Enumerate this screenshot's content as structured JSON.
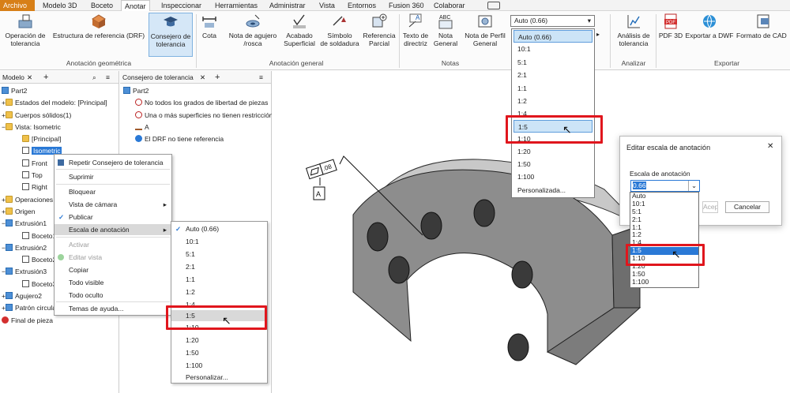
{
  "menu_tabs": [
    "Archivo",
    "Modelo 3D",
    "Boceto",
    "Anotar",
    "Inspeccionar",
    "Herramientas",
    "Administrar",
    "Vista",
    "Entornos",
    "Fusion 360",
    "Colaborar"
  ],
  "ribbon": {
    "buttons": [
      {
        "id": "op",
        "label": "Operación de\ntolerancia"
      },
      {
        "id": "drf",
        "label": "Estructura de referencia (DRF)"
      },
      {
        "id": "advisor",
        "label": "Consejero de\ntolerancia"
      },
      {
        "id": "cota",
        "label": "Cota"
      },
      {
        "id": "hole",
        "label": "Nota de agujero\n/rosca"
      },
      {
        "id": "finish",
        "label": "Acabado\nSuperficial"
      },
      {
        "id": "weld",
        "label": "Símbolo\nde soldadura"
      },
      {
        "id": "partial",
        "label": "Referencia\nParcial"
      },
      {
        "id": "leader",
        "label": "Texto de\ndirectriz"
      },
      {
        "id": "general",
        "label": "Nota\nGeneral"
      },
      {
        "id": "profile",
        "label": "Nota de Perfil\nGeneral"
      },
      {
        "id": "analysis",
        "label": "Análisis de\ntolerancia"
      },
      {
        "id": "pdf",
        "label": "PDF 3D"
      },
      {
        "id": "dwf",
        "label": "Exportar a DWF"
      },
      {
        "id": "cad",
        "label": "Formato de CAD"
      }
    ],
    "groups": [
      "Anotación geométrica",
      "Anotación general",
      "Notas",
      "Analizar",
      "Exportar"
    ],
    "scale_combo": "Auto (0.66)",
    "scale_list": [
      "Auto (0.66)",
      "10:1",
      "5:1",
      "2:1",
      "1:1",
      "1:2",
      "1:4",
      "1:5",
      "1:10",
      "1:20",
      "1:50",
      "1:100",
      "Personalizada..."
    ],
    "scale_selected": "1:5"
  },
  "model_panel": {
    "title": "Modelo",
    "tree": [
      "Part2",
      "Estados del modelo: [Principal]",
      "Cuerpos sólidos(1)",
      "Vista: Isometric",
      "[Principal]",
      "Isometric",
      "Front",
      "Top",
      "Right",
      "Operaciones",
      "Origen",
      "Extrusión1",
      "Boceto1",
      "Extrusión2",
      "Boceto2",
      "Extrusión3",
      "Boceto3",
      "Agujero2",
      "Patrón circular",
      "Final de pieza"
    ]
  },
  "advisor_panel": {
    "title": "Consejero de tolerancia",
    "tree": [
      "Part2",
      "No todos los grados de libertad de piezas",
      "Una o más superficies no tienen restricción",
      "A",
      "El DRF no tiene referencia"
    ]
  },
  "context_menu": [
    "Repetir Consejero de tolerancia",
    "Suprimir",
    "Bloquear",
    "Vista de cámara",
    "Publicar",
    "Escala de anotación",
    "Activar",
    "Editar vista",
    "Copiar",
    "Todo visible",
    "Todo oculto",
    "Temas de ayuda..."
  ],
  "submenu": [
    "Auto (0.66)",
    "10:1",
    "5:1",
    "2:1",
    "1:1",
    "1:2",
    "1:4",
    "1:5",
    "1:10",
    "1:20",
    "1:50",
    "1:100",
    "Personalizar..."
  ],
  "dialog": {
    "title": "Editar escala de anotación",
    "label": "Escala de anotación",
    "value": "0.66",
    "ok": "Aceptar",
    "cancel": "Cancelar",
    "list": [
      "Auto",
      "10:1",
      "5:1",
      "2:1",
      "1:1",
      "1:2",
      "1:4",
      "1:5",
      "1:10",
      "1:20",
      "1:50",
      "1:100"
    ]
  },
  "annotation": {
    "flatness_value": ".08",
    "datum": "A"
  }
}
